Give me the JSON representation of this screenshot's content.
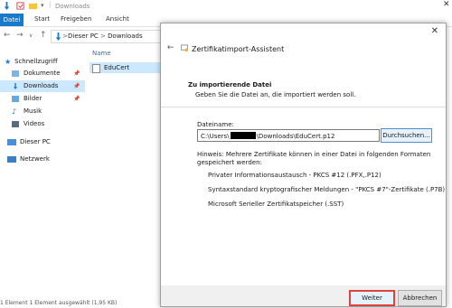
{
  "window": {
    "title": "Downloads"
  },
  "ribbon": {
    "tabs": [
      "Datei",
      "Start",
      "Freigeben",
      "Ansicht"
    ]
  },
  "address": {
    "crumbs": [
      "Dieser PC",
      ">",
      "Downloads"
    ],
    "separator": ">"
  },
  "navpane": {
    "quick_access": "Schnellzugriff",
    "items": [
      {
        "label": "Dokumente",
        "icon": "documents-icon"
      },
      {
        "label": "Downloads",
        "icon": "downloads-icon"
      },
      {
        "label": "Bilder",
        "icon": "pictures-icon"
      },
      {
        "label": "Musik",
        "icon": "music-icon"
      },
      {
        "label": "Videos",
        "icon": "videos-icon"
      }
    ],
    "this_pc": "Dieser PC",
    "network": "Netzwerk"
  },
  "filelist": {
    "column_name": "Name",
    "files": [
      {
        "name": "EduCert",
        "icon": "certificate-file-icon"
      }
    ]
  },
  "statusbar": {
    "text": "1 Element   1 Element ausgewählt (1,95 KB)"
  },
  "dialog": {
    "title": "Zertifikatimport-Assistent",
    "section_title": "Zu importierende Datei",
    "section_desc": "Geben Sie die Datei an, die importiert werden soll.",
    "filename_label": "Dateiname:",
    "filename_prefix": "C:\\Users\\",
    "filename_suffix": "\\Downloads\\EduCert.p12",
    "browse_label": "Durchsuchen...",
    "hint": "Hinweis: Mehrere Zertifikate können in einer Datei in folgenden Formaten gespeichert werden:",
    "formats": [
      "Privater Informationsaustausch - PKCS #12 (.PFX,.P12)",
      "Syntaxstandard kryptografischer Meldungen - \"PKCS #7\"-Zertifikate (.P7B)",
      "Microsoft Serieller Zertifikatspeicher (.SST)"
    ],
    "next_label": "Weiter",
    "cancel_label": "Abbrechen",
    "highlight_color": "#e0433c"
  },
  "colors": {
    "accent": "#1979ca",
    "selection": "#cce8ff"
  }
}
